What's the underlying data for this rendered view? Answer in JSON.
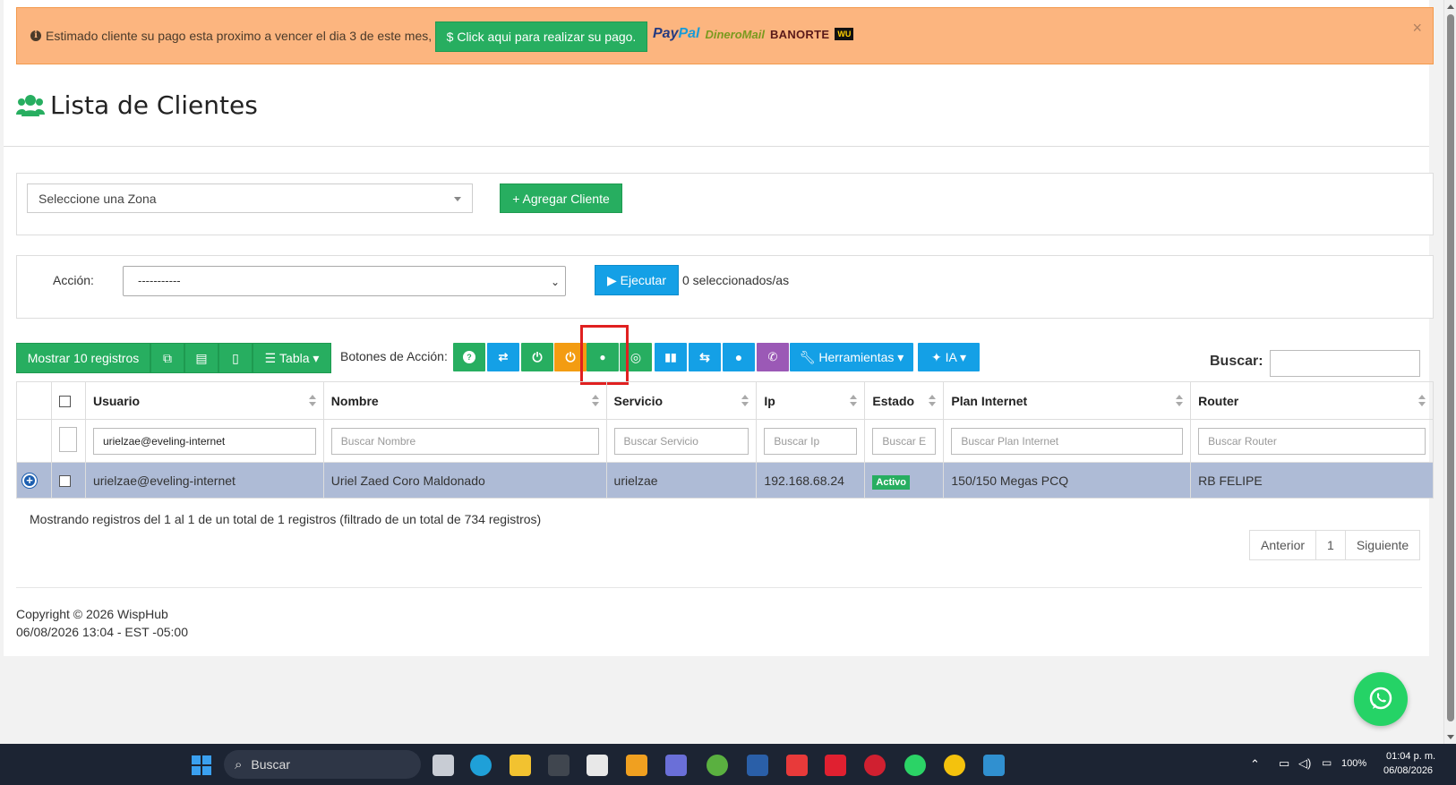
{
  "alert": {
    "message": "Estimado cliente su pago esta proximo a vencer el dia 3 de este mes,",
    "pay_button": "$ Click aqui para realizar su pago.",
    "logos": {
      "paypal_a": "Pay",
      "paypal_b": "Pal",
      "dinero": "DineroMail",
      "banorte": "BANORTE",
      "wu": "WU"
    },
    "close": "×"
  },
  "page": {
    "title": "Lista de Clientes"
  },
  "zone": {
    "placeholder": "Seleccione una Zona",
    "add_button": "+ Agregar Cliente"
  },
  "accion": {
    "label": "Acción:",
    "value": "-----------",
    "execute": "▶ Ejecutar",
    "selected": "0 seleccionados/as"
  },
  "toolbar": {
    "show": "Mostrar 10 registros",
    "tabla": "Tabla ▾",
    "actions_label": "Botones de Acción:",
    "herramientas": "Herramientas ▾",
    "ia": "IA ▾",
    "search_label": "Buscar:"
  },
  "colors": {
    "green": "#27ae60",
    "blue": "#14a0e6",
    "orange": "#f39c12",
    "purple": "#9b59b6",
    "row": "#aebbd6"
  },
  "table": {
    "headers": [
      "Usuario",
      "Nombre",
      "Servicio",
      "Ip",
      "Estado",
      "Plan Internet",
      "Router"
    ],
    "filters": [
      "urielzae@eveling-internet",
      "Buscar Nombre",
      "Buscar Servicio",
      "Buscar Ip",
      "Buscar E",
      "Buscar Plan Internet",
      "Buscar Router"
    ],
    "rows": [
      {
        "usuario": "urielzae@eveling-internet",
        "nombre": "Uriel Zaed Coro Maldonado",
        "servicio": "urielzae",
        "ip": "192.168.68.24",
        "estado": "Activo",
        "plan": "150/150 Megas PCQ",
        "router": "RB FELIPE"
      }
    ]
  },
  "info": "Mostrando registros del 1 al 1 de un total de 1 registros (filtrado de un total de 734 registros)",
  "pager": {
    "prev": "Anterior",
    "page": "1",
    "next": "Siguiente"
  },
  "footer": {
    "copyright": "Copyright © 2026 WispHub",
    "datetime": "06/08/2026 13:04 - EST -05:00"
  },
  "taskbar": {
    "search": "Buscar",
    "battery": "100%",
    "time": "01:04 p. m.",
    "date": "06/08/2026"
  }
}
